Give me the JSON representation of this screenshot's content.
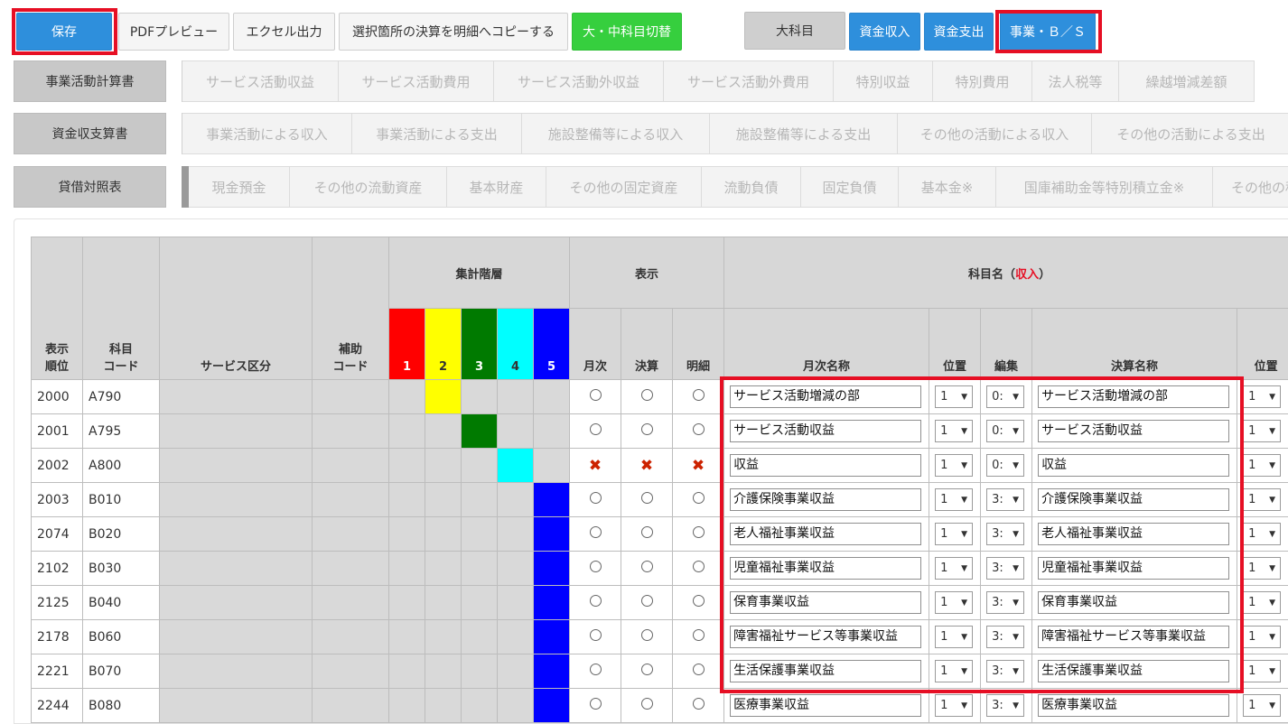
{
  "toolbar": {
    "save": "保存",
    "pdf_preview": "PDFプレビュー",
    "excel_export": "エクセル出力",
    "copy_selected": "選択箇所の決算を明細へコピーする",
    "toggle_subjects": "大・中科目切替",
    "major_subject": "大科目",
    "fund_income": "資金収入",
    "fund_expense": "資金支出",
    "business_bs": "事業・Ｂ／Ｓ"
  },
  "sections": [
    {
      "label": "事業活動計算書",
      "items": [
        "サービス活動収益",
        "サービス活動費用",
        "サービス活動外収益",
        "サービス活動外費用",
        "特別収益",
        "特別費用",
        "法人税等",
        "繰越増減差額"
      ]
    },
    {
      "label": "資金収支算書",
      "items": [
        "事業活動による収入",
        "事業活動による支出",
        "施設整備等による収入",
        "施設整備等による支出",
        "その他の活動による収入",
        "その他の活動による支出"
      ]
    },
    {
      "label": "貸借対照表",
      "items": [
        "現金預金",
        "その他の流動資産",
        "基本財産",
        "その他の固定資産",
        "流動負債",
        "固定負債",
        "基本金※",
        "国庫補助金等特別積立金※",
        "その他の積"
      ]
    }
  ],
  "table": {
    "headers": {
      "order_line1": "表示",
      "order_line2": "順位",
      "code_line1": "科目",
      "code_line2": "コード",
      "service": "サービス区分",
      "sub_code_line1": "補助",
      "sub_code_line2": "コード",
      "hierarchy": "集計階層",
      "levels": [
        "1",
        "2",
        "3",
        "4",
        "5"
      ],
      "display": "表示",
      "monthly": "月次",
      "settlement": "決算",
      "detail": "明細",
      "subject_name": "科目名（",
      "subject_name_red": "収入",
      "subject_name_end": "）",
      "monthly_name": "月次名称",
      "position": "位置",
      "edit": "編集",
      "settlement_name": "決算名称",
      "position2": "位置"
    },
    "rows": [
      {
        "order": "2000",
        "code": "A790",
        "level": 2,
        "marks": "radio",
        "monthly_name": "サービス活動増減の部",
        "pos": "1",
        "edit": "0:",
        "settle_name": "サービス活動増減の部",
        "pos2": "1"
      },
      {
        "order": "2001",
        "code": "A795",
        "level": 3,
        "marks": "radio",
        "monthly_name": "サービス活動収益",
        "pos": "1",
        "edit": "0:",
        "settle_name": "サービス活動収益",
        "pos2": "1"
      },
      {
        "order": "2002",
        "code": "A800",
        "level": 4,
        "marks": "cross",
        "monthly_name": "収益",
        "pos": "1",
        "edit": "0:",
        "settle_name": "収益",
        "pos2": "1"
      },
      {
        "order": "2003",
        "code": "B010",
        "level": 5,
        "marks": "radio",
        "monthly_name": "介護保険事業収益",
        "pos": "1",
        "edit": "3:",
        "settle_name": "介護保険事業収益",
        "pos2": "1"
      },
      {
        "order": "2074",
        "code": "B020",
        "level": 5,
        "marks": "radio",
        "monthly_name": "老人福祉事業収益",
        "pos": "1",
        "edit": "3:",
        "settle_name": "老人福祉事業収益",
        "pos2": "1"
      },
      {
        "order": "2102",
        "code": "B030",
        "level": 5,
        "marks": "radio",
        "monthly_name": "児童福祉事業収益",
        "pos": "1",
        "edit": "3:",
        "settle_name": "児童福祉事業収益",
        "pos2": "1"
      },
      {
        "order": "2125",
        "code": "B040",
        "level": 5,
        "marks": "radio",
        "monthly_name": "保育事業収益",
        "pos": "1",
        "edit": "3:",
        "settle_name": "保育事業収益",
        "pos2": "1"
      },
      {
        "order": "2178",
        "code": "B060",
        "level": 5,
        "marks": "radio",
        "monthly_name": "障害福祉サービス等事業収益",
        "pos": "1",
        "edit": "3:",
        "settle_name": "障害福祉サービス等事業収益",
        "pos2": "1"
      },
      {
        "order": "2221",
        "code": "B070",
        "level": 5,
        "marks": "radio",
        "monthly_name": "生活保護事業収益",
        "pos": "1",
        "edit": "3:",
        "settle_name": "生活保護事業収益",
        "pos2": "1"
      },
      {
        "order": "2244",
        "code": "B080",
        "level": 5,
        "marks": "radio",
        "monthly_name": "医療事業収益",
        "pos": "1",
        "edit": "3:",
        "settle_name": "医療事業収益",
        "pos2": "1"
      }
    ]
  },
  "colors": {
    "accent_blue": "#2e8fdc",
    "green": "#36cf3e",
    "highlight_red": "#e60f24",
    "level_colors": [
      "#ff0000",
      "#ffff00",
      "#007a00",
      "#00ffff",
      "#0000ff"
    ]
  }
}
